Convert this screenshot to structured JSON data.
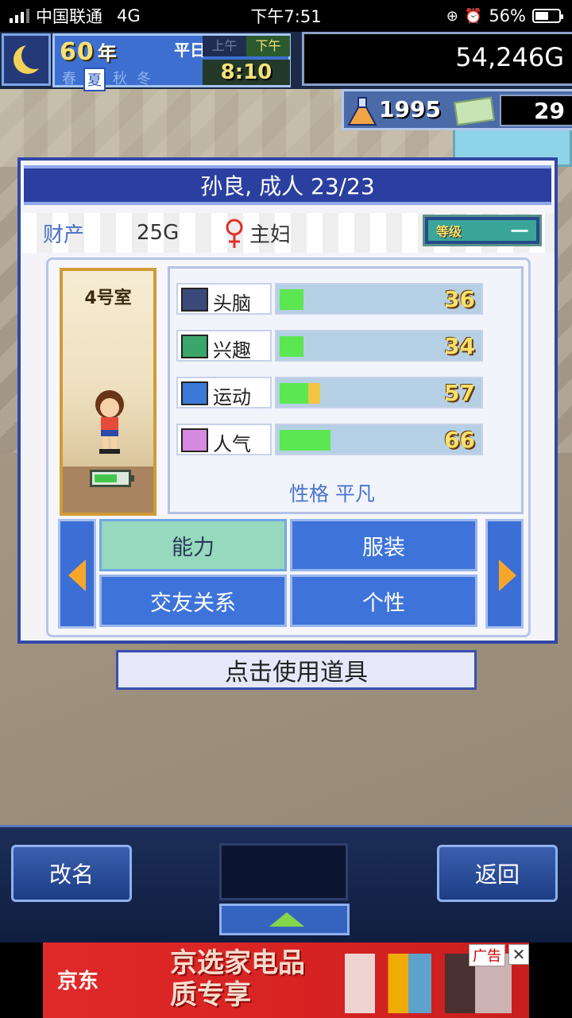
{
  "status_bar": {
    "carrier": "中国联通",
    "network": "4G",
    "time": "下午7:51",
    "battery": "56%",
    "battery_level": 0.56
  },
  "hud": {
    "year": "60",
    "year_unit": "年",
    "weekday": "平日",
    "seasons": [
      "春",
      "夏",
      "秋",
      "冬"
    ],
    "active_season": "夏",
    "am": "上午",
    "pm": "下午",
    "clock": "8:10",
    "money": "54,246G",
    "research_points": "1995",
    "tickets": "29"
  },
  "panel": {
    "title": "孙良, 成人 23/23",
    "asset_label": "财产",
    "asset_value": "25G",
    "job": "主妇",
    "rank_label": "等级",
    "rank_value": "一",
    "room": "4号室",
    "energy_level": 0.7,
    "stats": [
      {
        "name": "头脑",
        "value": "36",
        "fill": 0.12,
        "icon": "brain-monitor-icon"
      },
      {
        "name": "兴趣",
        "value": "34",
        "fill": 0.12,
        "icon": "interest-bubble-icon"
      },
      {
        "name": "运动",
        "value": "57",
        "fill": 0.14,
        "extra_fill": 0.06,
        "icon": "sports-figure-icon"
      },
      {
        "name": "人气",
        "value": "66",
        "fill": 0.25,
        "icon": "popularity-star-icon"
      }
    ],
    "personality": "性格 平凡",
    "tabs": [
      {
        "label": "能力",
        "active": true
      },
      {
        "label": "服装",
        "active": false
      },
      {
        "label": "交友关系",
        "active": false
      },
      {
        "label": "个性",
        "active": false
      }
    ]
  },
  "use_item_label": "点击使用道具",
  "bottom": {
    "rename_label": "改名",
    "back_label": "返回"
  },
  "ad": {
    "brand": "京东",
    "headline": "京选家电品质专享",
    "tag": "广告",
    "close": "✕"
  },
  "colors": {
    "accent_blue": "#3e73d9",
    "active_tab": "#96d9be",
    "stat_fill": "#5ce652",
    "stat_value": "#f8e06a"
  }
}
